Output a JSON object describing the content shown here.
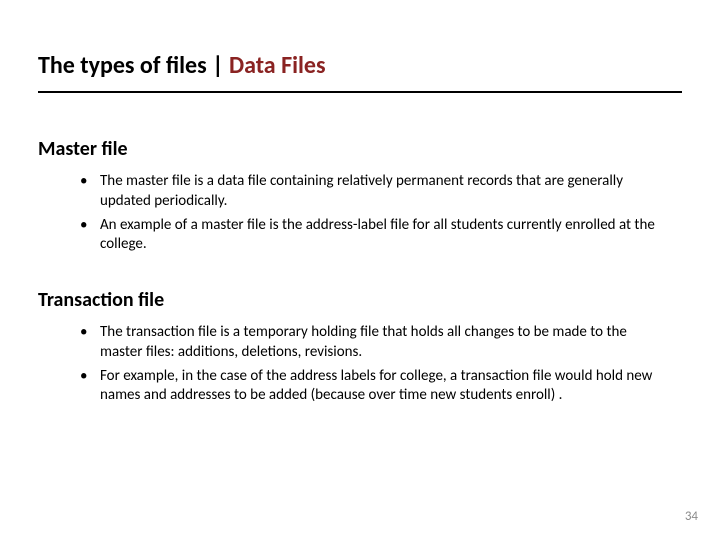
{
  "title": {
    "part1": "The types of files | ",
    "part2": "Data Files"
  },
  "section1": {
    "heading": "Master file",
    "bullets": [
      "The master file is a data file containing relatively permanent records that are generally updated periodically.",
      "An example of a master file is the address-label file for all students currently enrolled at the college."
    ]
  },
  "section2": {
    "heading": "Transaction file",
    "bullets": [
      "The transaction file is a temporary holding file that holds all changes to be made to the master files: additions, deletions, revisions.",
      "For example, in the case of the address labels for college, a transaction file would hold new names and addresses to be added (because over time new students enroll) ."
    ]
  },
  "page_number": "34"
}
